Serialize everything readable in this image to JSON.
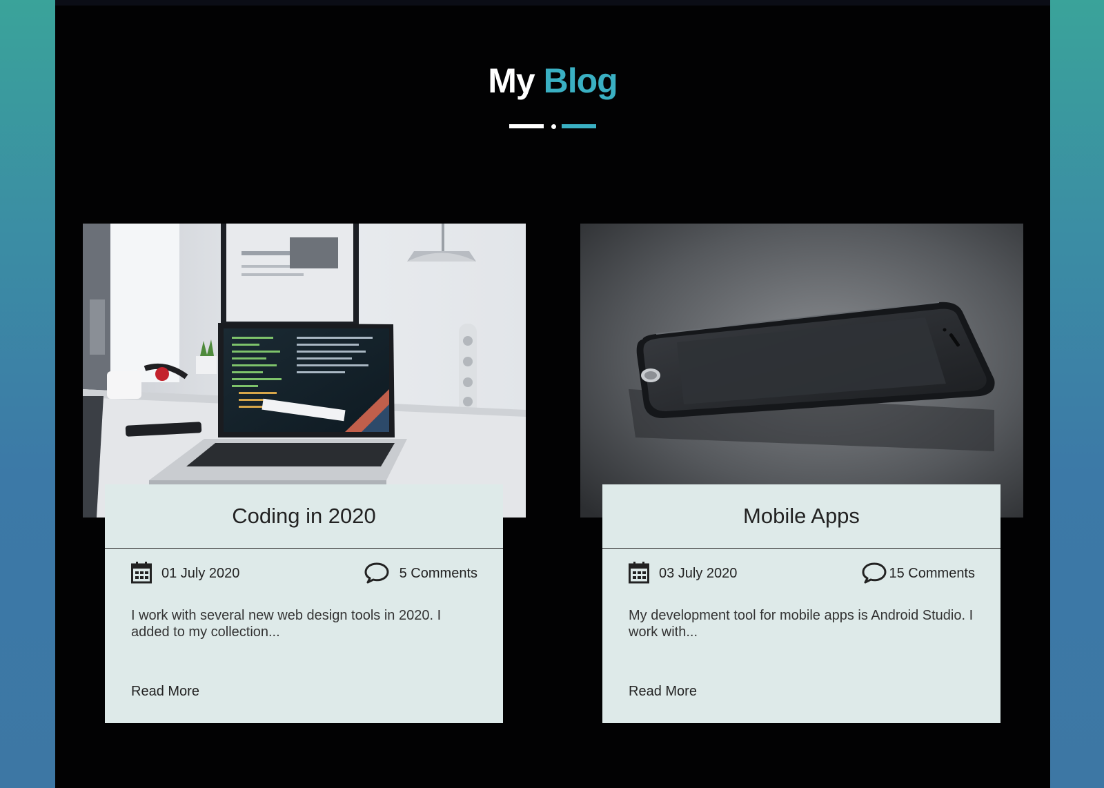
{
  "header": {
    "title_part1": "My",
    "title_part2": "Blog"
  },
  "colors": {
    "accent": "#3ab0c3",
    "panel": "#deeae9",
    "background": "#020203"
  },
  "posts": [
    {
      "title": "Coding in 2020",
      "date": "01 July 2020",
      "comments": "5 Comments",
      "excerpt": "I work with several new web design tools in 2020. I added to my collection...",
      "read_more": "Read More",
      "image_icon": "laptop-desk-photo"
    },
    {
      "title": "Mobile Apps",
      "date": "03 July 2020",
      "comments": "15 Comments",
      "excerpt": "My development tool for mobile apps is Android Studio. I work with...",
      "read_more": "Read More",
      "image_icon": "smartphone-photo"
    }
  ]
}
